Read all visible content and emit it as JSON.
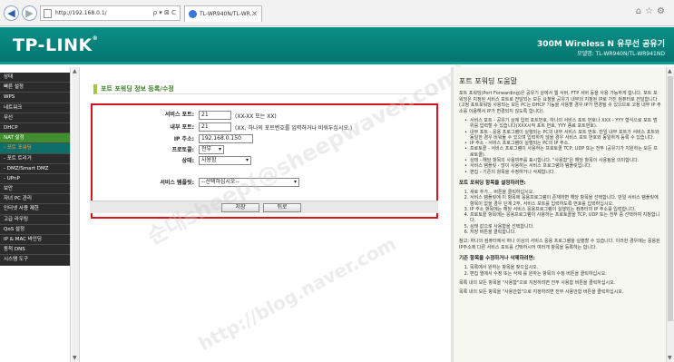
{
  "browser": {
    "url": "http://192.168.0.1/",
    "address_controls": "ρ ▾ ⊠ C",
    "tab_title": "TL-WR940N/TL-WR...",
    "back_glyph": "◀",
    "forward_glyph": "▶",
    "tab_close": "×",
    "toolbar_icons": "⌂☆⚙"
  },
  "banner": {
    "logo": "TP-LINK",
    "logo_mark": "®",
    "product_line": "300M Wireless N 유무선 공유기",
    "model": "모델명: TL-WR940N/TL-WR941ND"
  },
  "sidebar": {
    "items": [
      {
        "label": "상태",
        "state": "normal"
      },
      {
        "label": "빠른 설정",
        "state": "normal"
      },
      {
        "label": "WPS",
        "state": "normal"
      },
      {
        "label": "네트워크",
        "state": "normal"
      },
      {
        "label": "무선",
        "state": "normal"
      },
      {
        "label": "DHCP",
        "state": "normal"
      },
      {
        "label": "NAT 설정",
        "state": "active"
      },
      {
        "label": "- 포트 포워딩",
        "state": "subactive"
      },
      {
        "label": "- 포트 트리거",
        "state": "sub"
      },
      {
        "label": "- DMZ/Smart DMZ",
        "state": "sub"
      },
      {
        "label": "- UPnP",
        "state": "sub"
      },
      {
        "label": "보안",
        "state": "normal"
      },
      {
        "label": "자녀 PC 관리",
        "state": "normal"
      },
      {
        "label": "인터넷 사용 제한",
        "state": "normal"
      },
      {
        "label": "고급 라우팅",
        "state": "normal"
      },
      {
        "label": "QoS 설정",
        "state": "normal"
      },
      {
        "label": "IP & MAC 바인딩",
        "state": "normal"
      },
      {
        "label": "동적 DNS",
        "state": "normal"
      },
      {
        "label": "시스템 도구",
        "state": "normal"
      }
    ]
  },
  "form": {
    "title": "포트 포워딩 정보 등록/수정",
    "service_port_label": "서비스 포트:",
    "service_port_value": "21",
    "service_port_hint": "(XX-XX 또는 XX)",
    "internal_port_label": "내부 포트:",
    "internal_port_value": "21",
    "internal_port_hint": "(XX, 하나의 포트번호를 입력하거나 비워두십시오.)",
    "ip_label": "IP 주소:",
    "ip_value": "192.168.0.150",
    "protocol_label": "프로토콜:",
    "protocol_value": "전부",
    "status_label": "상태:",
    "status_value": "사용함",
    "common_label": "서비스 템플릿:",
    "common_value": "--선택하십시오--",
    "save_label": "저장",
    "back_label": "뒤로"
  },
  "watermark": {
    "line1": "순대sheep(@sheepwaver.com)",
    "line2": "http://blog.naver.com"
  },
  "help": {
    "title": "포트 포워딩 도움말",
    "intro": "포트 포워딩(Port Forwarding)은 공유기 상에서 웹 서버, FTP 서버 등을 사용 가능하게 합니다. 포트 포워딩은 지정된 서비스 포트로 전달되는 모든 요청을 공유기 내부의 지정된 IP로 가진 컴퓨터로 전달합니다(고정 포트포워딩 사용되는 모든 PC는 DHCP 기능을 사용할 경우 IP가 변경될 수 있으므로 고정 내부 IP 주소를 이용해서 IP가 변경되지 않도록 합니다).",
    "bullets": [
      "서비스 포트 - 공유기 상에 입력 포트번호, 하나의 서비스 포트 번호나 XXX - YYY 형식으로 포트 범위를 입력할 수 있습니다(XXX시작 포트 번호, YYY 종료 포트번호).",
      "내부 포트 - 응용 프로그램이 실행되는 PC의 내부 서비스 포트 번호. 만일 내부 포트가 서비스 포트와 동일한 경우 비워둘 수 있으며 입력하지 않을 경우 서비스 포트 번호와 동일하게 등록 수 있습니다.",
      "IP 주소 - 서비스 프로그램이 실행되는 PC의 IP 주소.",
      "프로토콜 - 서비스 프로그램이 사용하는 프로토콜 TCP, UDP 또는 전부 (공유기가 지원하는 모든 프로토콜).",
      "상태 - 해당 항목의 사용여부를 표시합니다. \"사용함\"은 해당 항목이 사용됨을 의미합니다.",
      "서비스 템플릿 - 많이 사용하는 서비스 프로그램의 템플릿입니다.",
      "편집 - 기존의 항목을 수정하거나 삭제합니다."
    ],
    "setup_title": "포트 포워딩 항목을 설정하려면:",
    "setup_steps": [
      "새로 추가... 버튼을 클릭하십시오.",
      "서비스 템플릿에 이 항목에 응용프로그램이 존재하면 해당 항목을 선택합니다. 만일 서비스 템플릿에 항목이 없을 경우 단계 2부, 서비스 포트를 입력하도록 번호를 입력하십시오.",
      "IP 주소 항목에는 해당 서비스 응용프로그램이 실행되는 컴퓨터의 IP 주소를 입력합니다.",
      "프로토콜 항목에는 응용프로그램이 사용하는 프로토콜을 TCP, UDP 또는 전부 중 선택하여 지정합니다.",
      "상태 값으로 사용함을 선택합니다.",
      "저장 버튼을 클릭합니다."
    ],
    "note": "참고: 하나의 컴퓨터에서 하나 이상의 서비스 응용 프로그램을 실행할 수 있습니다. 이러한 경우에는 응용된 IP주소에 다른 서비스 포트를 선택하시어 여러개 항목을 등록하는 합니다.",
    "edit_title": "기존 항목을 수정하거나 삭제하려면:",
    "edit_steps": [
      "목록에서 원하는 항목을 찾으십시오.",
      "편집 열에서 수정 또는 삭제 를 원하는 항목의 수정 버튼을 클릭하십시오."
    ],
    "footer1": "목록 내의 모든 항목을 \"사용함\"으로 지정하려면 전부 사용함 버튼을 클릭하십시오.",
    "footer2": "목록 내의 모든 항목을 \"사용안함\"으로 지정하려면 전부 사용안함 버튼을 클릭하십시오."
  }
}
